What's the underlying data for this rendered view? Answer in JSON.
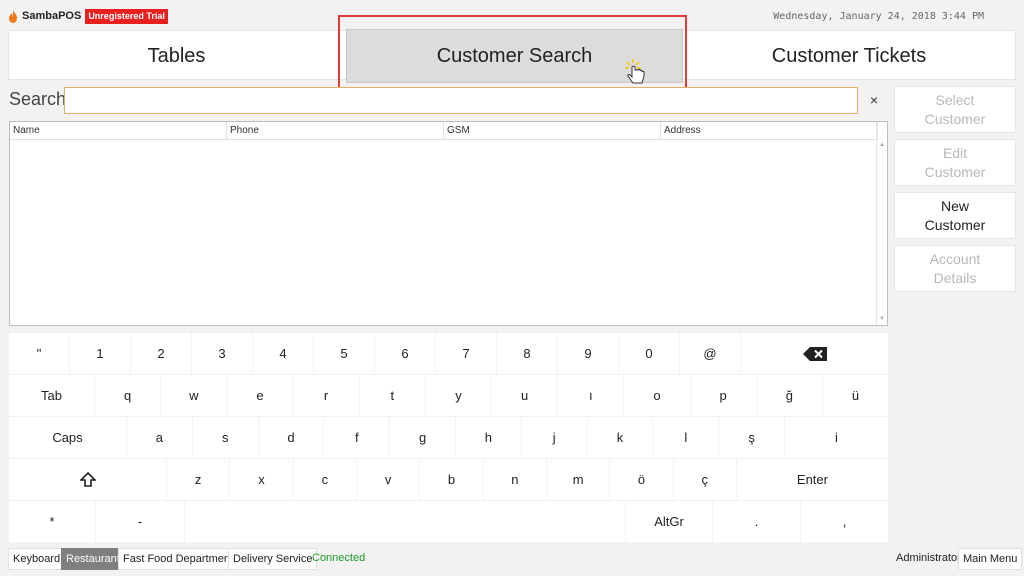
{
  "app": {
    "brand": "SambaPOS",
    "trial_badge": "Unregistered Trial",
    "datetime": "Wednesday, January 24, 2018 3:44 PM"
  },
  "tabs": [
    {
      "label": "Tables"
    },
    {
      "label": "Customer Search"
    },
    {
      "label": "Customer Tickets"
    }
  ],
  "search": {
    "label": "Search",
    "value": "",
    "placeholder": "",
    "clear": "×"
  },
  "table": {
    "columns": [
      "Name",
      "Phone",
      "GSM",
      "Address"
    ]
  },
  "side_buttons": [
    {
      "line1": "Select",
      "line2": "Customer"
    },
    {
      "line1": "Edit",
      "line2": "Customer"
    },
    {
      "line1": "New",
      "line2": "Customer"
    },
    {
      "line1": "Account",
      "line2": "Details"
    }
  ],
  "keyboard": {
    "row1": [
      "\"",
      "1",
      "2",
      "3",
      "4",
      "5",
      "6",
      "7",
      "8",
      "9",
      "0",
      "@"
    ],
    "row2": [
      "Tab",
      "q",
      "w",
      "e",
      "r",
      "t",
      "y",
      "u",
      "ı",
      "o",
      "p",
      "ğ",
      "ü"
    ],
    "row3": [
      "Caps",
      "a",
      "s",
      "d",
      "f",
      "g",
      "h",
      "j",
      "k",
      "l",
      "ş",
      "i"
    ],
    "row4": [
      "z",
      "x",
      "c",
      "v",
      "b",
      "n",
      "m",
      "ö",
      "ç",
      "Enter"
    ],
    "row5": [
      "*",
      "-",
      "AltGr",
      ".",
      ","
    ]
  },
  "status_bar": {
    "keyboard": "Keyboard",
    "restaurant": "Restaurant",
    "fast_food": "Fast Food Department",
    "delivery": "Delivery Service",
    "connected": "Connected",
    "user": "Administrator",
    "main_menu": "Main Menu"
  },
  "colors": {
    "accent_red": "#e8201f",
    "connected_green": "#1a9a2a",
    "search_border": "#e3b06a"
  }
}
